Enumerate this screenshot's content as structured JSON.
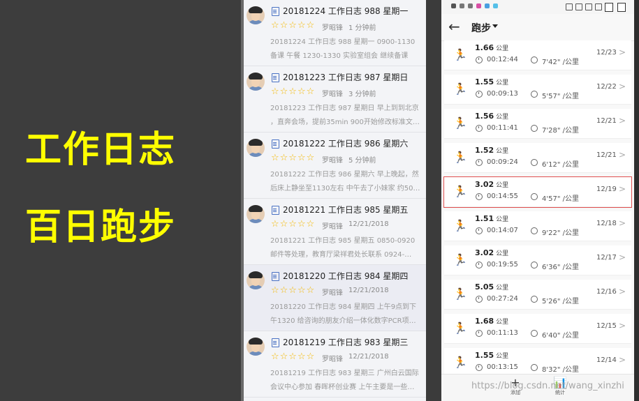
{
  "left_panel": {
    "line1": "工作日志",
    "line2": "百日跑步",
    "text_color": "#ffff00"
  },
  "blog": {
    "entries": [
      {
        "title": "20181224 工作日志 988 星期一",
        "stars": "☆☆☆☆☆",
        "author": "罗昭锋",
        "time": "1 分钟前",
        "body1": "20181224 工作日志 988 星期一 0900-1130",
        "body2": "备课 午餐 1230-1330 实验室组会 继续备课"
      },
      {
        "title": "20181223 工作日志 987 星期日",
        "stars": "☆☆☆☆☆",
        "author": "罗昭锋",
        "time": "3 分钟前",
        "body1": "20181223 工作日志 987 星期日 早上到到北京",
        "body2": "，直奔会场，提前35min 900开始修改标准文…"
      },
      {
        "title": "20181222 工作日志 986 星期六",
        "stars": "☆☆☆☆☆",
        "author": "罗昭锋",
        "time": "5 分钟前",
        "body1": "20181222 工作日志 986 星期六 早上晚起，然",
        "body2": "后床上静坐至1130左右 中午去了小妹家 约50…"
      },
      {
        "title": "20181221 工作日志 985 星期五",
        "stars": "☆☆☆☆☆",
        "author": "罗昭锋",
        "time": "12/21/2018",
        "body1": "20181221 工作日志 985 星期五 0850-0920",
        "body2": "邮件等处理，教育厅梁祥君处长联系 0924-…"
      },
      {
        "title": "20181220 工作日志 984 星期四",
        "stars": "☆☆☆☆☆",
        "author": "罗昭锋",
        "time": "12/21/2018",
        "body1": "20181220 工作日志 984 星期四 上午9点到下",
        "body2": "午1320 给咨询的朋友介绍一体化数字PCR项…"
      },
      {
        "title": "20181219 工作日志 983 星期三",
        "stars": "☆☆☆☆☆",
        "author": "罗昭锋",
        "time": "12/21/2018",
        "body1": "20181219 工作日志 983 星期三 广州白云国际",
        "body2": "会议中心参加 春晖杯创业赛 上午主要是一些…"
      }
    ]
  },
  "phone": {
    "header": {
      "back_icon": "←",
      "title": "跑步"
    },
    "runs": [
      {
        "distance": "1.66",
        "unit": "公里",
        "duration": "00:12:44",
        "pace": "7'42\" /公里",
        "date": "12/23",
        "highlighted": false
      },
      {
        "distance": "1.55",
        "unit": "公里",
        "duration": "00:09:13",
        "pace": "5'57\" /公里",
        "date": "12/22",
        "highlighted": false
      },
      {
        "distance": "1.56",
        "unit": "公里",
        "duration": "00:11:41",
        "pace": "7'28\" /公里",
        "date": "12/21",
        "highlighted": false
      },
      {
        "distance": "1.52",
        "unit": "公里",
        "duration": "00:09:24",
        "pace": "6'12\" /公里",
        "date": "12/21",
        "highlighted": false
      },
      {
        "distance": "3.02",
        "unit": "公里",
        "duration": "00:14:55",
        "pace": "4'57\" /公里",
        "date": "12/19",
        "highlighted": true
      },
      {
        "distance": "1.51",
        "unit": "公里",
        "duration": "00:14:07",
        "pace": "9'22\" /公里",
        "date": "12/18",
        "highlighted": false
      },
      {
        "distance": "3.02",
        "unit": "公里",
        "duration": "00:19:55",
        "pace": "6'36\" /公里",
        "date": "12/17",
        "highlighted": false
      },
      {
        "distance": "5.05",
        "unit": "公里",
        "duration": "00:27:24",
        "pace": "5'26\" /公里",
        "date": "12/16",
        "highlighted": false
      },
      {
        "distance": "1.68",
        "unit": "公里",
        "duration": "00:11:13",
        "pace": "6'40\" /公里",
        "date": "12/15",
        "highlighted": false
      },
      {
        "distance": "1.55",
        "unit": "公里",
        "duration": "00:13:15",
        "pace": "8'32\" /公里",
        "date": "12/14",
        "highlighted": false
      }
    ],
    "bottom": {
      "add_label": "添加",
      "add_icon": "+",
      "stats_label": "统计",
      "stats_icon": "📊"
    }
  },
  "watermark": "https://blog.csdn.net/wang_xinzhi",
  "colors": {
    "highlight": "#e05050",
    "stars": "#f3b800",
    "doc_icon": "#4a72c4"
  }
}
